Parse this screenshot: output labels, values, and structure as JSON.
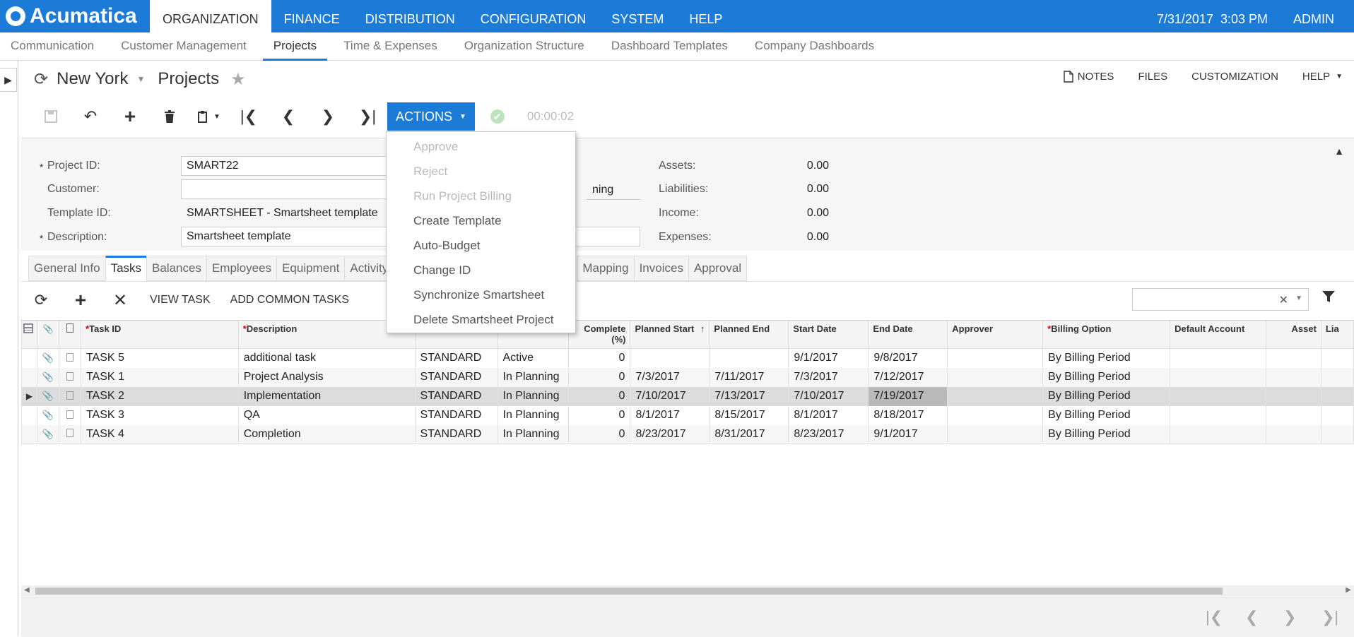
{
  "app": {
    "logo_text": "Acumatica"
  },
  "mainnav": [
    "ORGANIZATION",
    "FINANCE",
    "DISTRIBUTION",
    "CONFIGURATION",
    "SYSTEM",
    "HELP"
  ],
  "topright": {
    "datetime": "7/31/2017  3:03 PM",
    "user": "ADMIN"
  },
  "subnav": [
    "Communication",
    "Customer Management",
    "Projects",
    "Time & Expenses",
    "Organization Structure",
    "Dashboard Templates",
    "Company Dashboards"
  ],
  "page": {
    "site": "New York",
    "title": "Projects"
  },
  "headright": {
    "notes": "NOTES",
    "files": "FILES",
    "customization": "CUSTOMIZATION",
    "help": "HELP"
  },
  "toolbar": {
    "actions": "ACTIONS",
    "timer": "00:00:02"
  },
  "actions_menu": [
    {
      "label": "Approve",
      "enabled": false
    },
    {
      "label": "Reject",
      "enabled": false
    },
    {
      "label": "Run Project Billing",
      "enabled": false
    },
    {
      "label": "Create Template",
      "enabled": true
    },
    {
      "label": "Auto-Budget",
      "enabled": true
    },
    {
      "label": "Change ID",
      "enabled": true
    },
    {
      "label": "Synchronize Smartsheet",
      "enabled": true
    },
    {
      "label": "Delete Smartsheet Project",
      "enabled": true
    }
  ],
  "form": {
    "project_id_label": "Project ID:",
    "project_id": "SMART22",
    "customer_label": "Customer:",
    "customer": "",
    "template_label": "Template ID:",
    "template": "SMARTSHEET - Smartsheet template",
    "description_label": "Description:",
    "description": "Smartsheet template",
    "status_partial": "ning",
    "assets_label": "Assets:",
    "assets": "0.00",
    "liabilities_label": "Liabilities:",
    "liabilities": "0.00",
    "income_label": "Income:",
    "income": "0.00",
    "expenses_label": "Expenses:",
    "expenses": "0.00"
  },
  "tabs": [
    "General Info",
    "Tasks",
    "Balances",
    "Employees",
    "Equipment",
    "Activity",
    "Mapping",
    "Invoices",
    "Approval"
  ],
  "grid_toolbar": {
    "view_task": "VIEW TASK",
    "add_common": "ADD COMMON TASKS"
  },
  "columns": {
    "task_id": "Task ID",
    "description": "Description",
    "complete": "Complete (%)",
    "planned_start": "Planned Start",
    "planned_end": "Planned End",
    "start_date": "Start Date",
    "end_date": "End Date",
    "approver": "Approver",
    "billing_option": "Billing Option",
    "default_account": "Default Account",
    "asset": "Asset",
    "lia": "Lia"
  },
  "rows": [
    {
      "task_id": "TASK 5",
      "description": "additional task",
      "rate": "STANDARD",
      "status": "Active",
      "complete": "0",
      "planned_start": "",
      "planned_end": "",
      "start_date": "9/1/2017",
      "end_date": "9/8/2017",
      "approver": "",
      "billing": "By Billing Period"
    },
    {
      "task_id": "TASK 1",
      "description": "Project Analysis",
      "rate": "STANDARD",
      "status": "In Planning",
      "complete": "0",
      "planned_start": "7/3/2017",
      "planned_end": "7/11/2017",
      "start_date": "7/3/2017",
      "end_date": "7/12/2017",
      "approver": "",
      "billing": "By Billing Period"
    },
    {
      "task_id": "TASK 2",
      "description": "Implementation",
      "rate": "STANDARD",
      "status": "In Planning",
      "complete": "0",
      "planned_start": "7/10/2017",
      "planned_end": "7/13/2017",
      "start_date": "7/10/2017",
      "end_date": "7/19/2017",
      "approver": "",
      "billing": "By Billing Period"
    },
    {
      "task_id": "TASK 3",
      "description": "QA",
      "rate": "STANDARD",
      "status": "In Planning",
      "complete": "0",
      "planned_start": "8/1/2017",
      "planned_end": "8/15/2017",
      "start_date": "8/1/2017",
      "end_date": "8/18/2017",
      "approver": "",
      "billing": "By Billing Period"
    },
    {
      "task_id": "TASK 4",
      "description": "Completion",
      "rate": "STANDARD",
      "status": "In Planning",
      "complete": "0",
      "planned_start": "8/23/2017",
      "planned_end": "8/31/2017",
      "start_date": "8/23/2017",
      "end_date": "9/1/2017",
      "approver": "",
      "billing": "By Billing Period"
    }
  ],
  "colors": {
    "brand": "#1c7bd6",
    "selected_row": "#dcdcdc",
    "current_cell": "#b9b9b9"
  }
}
